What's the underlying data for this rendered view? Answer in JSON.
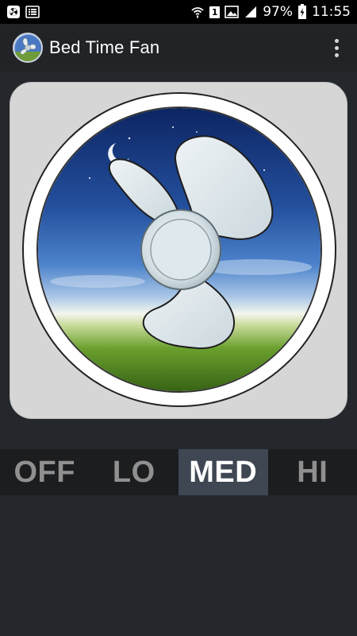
{
  "status_bar": {
    "battery_percent": "97%",
    "time": "11:55",
    "sim_slot": "1",
    "icons": [
      "app-notification-icon",
      "list-notification-icon",
      "wifi-icon",
      "sim-icon",
      "image-icon",
      "signal-icon",
      "battery-icon"
    ]
  },
  "app_bar": {
    "title": "Bed Time Fan",
    "logo_icon": "fan-logo-icon",
    "menu_icon": "overflow-menu-icon"
  },
  "fan": {
    "icon": "fan-blades-icon",
    "colors": {
      "card": "#d6d6d6",
      "ring": "#ffffff",
      "sky_top": "#0e2a6e",
      "sky_mid": "#3f79c9",
      "horizon": "#eef3e6",
      "grass": "#4f8a1c",
      "blade": "#dde6ea"
    }
  },
  "speed_controls": {
    "options": [
      "OFF",
      "LO",
      "MED",
      "HI"
    ],
    "selected": "MED",
    "active_color": "#3e4752",
    "inactive_text_color": "#909090"
  }
}
